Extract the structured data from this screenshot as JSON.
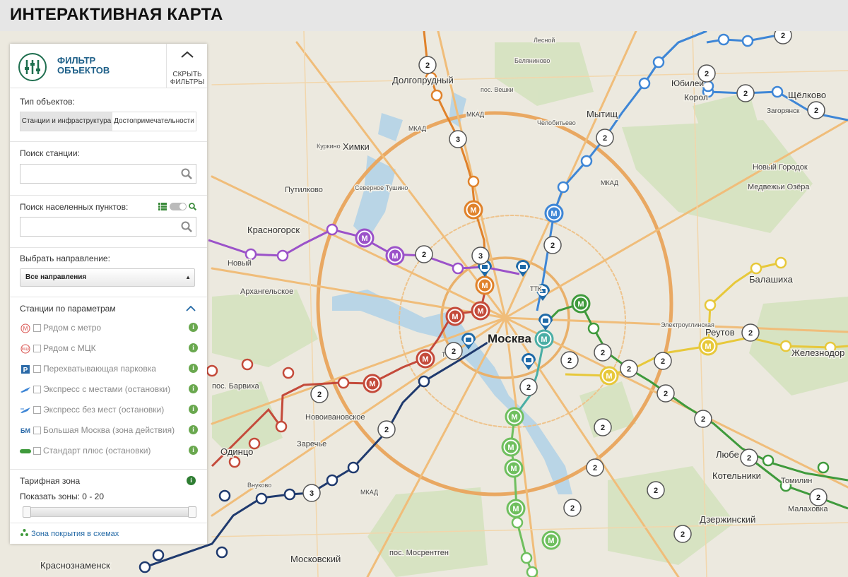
{
  "header": {
    "title": "ИНТЕРАКТИВНАЯ КАРТА"
  },
  "panel": {
    "logo_text": "ФИЛЬТР ОБЪЕКТОВ",
    "hide_button": "СКРЫТЬ ФИЛЬТРЫ",
    "object_type_label": "Тип объектов:",
    "tabs": [
      {
        "label": "Станции и инфраструктура",
        "active": true
      },
      {
        "label": "Достопримечательности",
        "active": false
      }
    ],
    "station_search_label": "Поиск станции:",
    "station_search_value": "",
    "locality_search_label": "Поиск населенных пунктов:",
    "locality_search_value": "",
    "direction_label": "Выбрать направление:",
    "direction_value": "Все направления",
    "params_label": "Станции по параметрам",
    "params": [
      {
        "icon": "metro-icon",
        "label": "Рядом с метро",
        "checked": false
      },
      {
        "icon": "mcc-icon",
        "label": "Рядом с МЦК",
        "checked": false
      },
      {
        "icon": "parking-icon",
        "label": "Перехватывающая парковка",
        "checked": false
      },
      {
        "icon": "express-seats-icon",
        "label": "Экспресс с местами (остановки)",
        "checked": false
      },
      {
        "icon": "express-no-seats-icon",
        "label": "Экспресс без мест (остановки)",
        "checked": false
      },
      {
        "icon": "bm-icon",
        "label": "Большая Москва (зона действия)",
        "checked": false
      },
      {
        "icon": "standard-plus-icon",
        "label": "Стандарт плюс (остановки)",
        "checked": false
      }
    ],
    "tariff_label": "Тарифная зона",
    "zones_label": "Показать зоны: 0 - 20",
    "zone_range": [
      0,
      20
    ],
    "coverage_link": "Зона покрытия в схемах"
  },
  "map": {
    "labels": {
      "moscow": "Москва",
      "khimki": "Химки",
      "dolgoprudny": "Долгопрудный",
      "mytishchi": "Мытищ",
      "korolev": "Корол",
      "shchelkovo": "Щёлково",
      "yubileiny": "Юбилеи",
      "krasnogorsk": "Красногорск",
      "putilkovo": "Путилково",
      "balashikha": "Балашиха",
      "reutov": "Реутов",
      "zheleznodor": "Железнодор",
      "lyubertsy": "Любе",
      "kotelniki": "Котельники",
      "dzerzhinsky": "Дзержинский",
      "odintsovo": "Одинцо",
      "krasnoznamensk": "Краснознаменск",
      "moskovsky": "Московский",
      "barvikha": "пос. Барвиха",
      "novy": "Новый",
      "arkhangelskoe": "Архангельское",
      "novoivanovskoe": "Новоивановское",
      "zarechye": "Заречье",
      "mosrentgen": "пос. Мосрентген",
      "tomilino": "Томилин",
      "malakhovka": "Малаховка",
      "novy_gorodok": "Новый Городок",
      "medvezhyi": "Медвежьи Озёра",
      "zagoryansky": "Загорянск",
      "belyaninovo": "Беляниново",
      "chelobityevo": "Челобитьево",
      "skhodnya": "Северное Тушино",
      "kurkino": "Куркино",
      "mkad1": "МКАД",
      "mkad2": "МКАД",
      "mkad3": "МКАД",
      "ttk1": "ТТК",
      "ttk2": "ТТК",
      "mkad4": "МКАД",
      "lukino": "пос. Вешки",
      "elektrougli": "Электроуглинская",
      "lesnoy": "Лесной",
      "vnukovo": "Внуково"
    },
    "cluster_counts": [
      "2",
      "3",
      "2",
      "2",
      "2",
      "2",
      "2",
      "2",
      "2",
      "3",
      "2",
      "2",
      "2",
      "2",
      "2",
      "2",
      "2",
      "2",
      "2",
      "2",
      "2",
      "2",
      "2",
      "2",
      "2",
      "2",
      "2",
      "3",
      "2"
    ],
    "colors": {
      "purple_line": "#9b52c9",
      "red_line": "#c44a3a",
      "orange_line": "#e0822b",
      "blue_line": "#3e86d6",
      "green_line": "#3f9a3c",
      "yellow_line": "#e7c83a",
      "navy_line": "#1f3a6e",
      "light_green_line": "#6fbf5e",
      "teal_line": "#4aaea5",
      "road_major": "#f4c07a",
      "road_mkad": "#e8a35a",
      "water": "#b6d3e3",
      "forest": "#cfe0b9"
    }
  }
}
